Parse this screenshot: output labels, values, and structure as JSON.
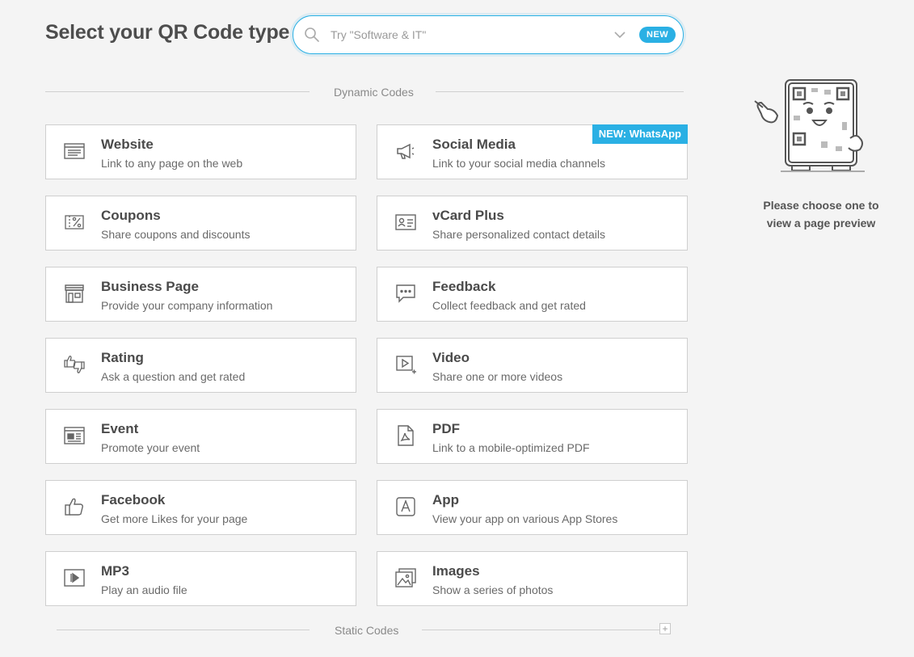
{
  "page_title": "Select your QR Code type",
  "search": {
    "placeholder": "Try \"Software & IT\"",
    "badge": "NEW"
  },
  "sections": {
    "dynamic": "Dynamic Codes",
    "static": "Static Codes"
  },
  "cards": [
    {
      "title": "Website",
      "desc": "Link to any page on the web",
      "icon": "website-icon"
    },
    {
      "title": "Social Media",
      "desc": "Link to your social media channels",
      "icon": "megaphone-icon",
      "ribbon": "NEW: WhatsApp"
    },
    {
      "title": "Coupons",
      "desc": "Share coupons and discounts",
      "icon": "coupon-icon"
    },
    {
      "title": "vCard Plus",
      "desc": "Share personalized contact details",
      "icon": "contact-card-icon"
    },
    {
      "title": "Business Page",
      "desc": "Provide your company information",
      "icon": "storefront-icon"
    },
    {
      "title": "Feedback",
      "desc": "Collect feedback and get rated",
      "icon": "chat-bubble-icon"
    },
    {
      "title": "Rating",
      "desc": "Ask a question and get rated",
      "icon": "thumbs-up-down-icon"
    },
    {
      "title": "Video",
      "desc": "Share one or more videos",
      "icon": "video-play-icon"
    },
    {
      "title": "Event",
      "desc": "Promote your event",
      "icon": "event-icon"
    },
    {
      "title": "PDF",
      "desc": "Link to a mobile-optimized PDF",
      "icon": "pdf-icon"
    },
    {
      "title": "Facebook",
      "desc": "Get more Likes for your page",
      "icon": "like-icon"
    },
    {
      "title": "App",
      "desc": "View your app on various App Stores",
      "icon": "app-store-icon"
    },
    {
      "title": "MP3",
      "desc": "Play an audio file",
      "icon": "audio-play-icon"
    },
    {
      "title": "Images",
      "desc": "Show a series of photos",
      "icon": "images-icon"
    }
  ],
  "preview": {
    "text": "Please choose one to view a page preview"
  },
  "static_expand": "+",
  "colors": {
    "accent": "#2ab0e4",
    "background": "#f4f4f4",
    "card_border": "#cfcfcf"
  }
}
